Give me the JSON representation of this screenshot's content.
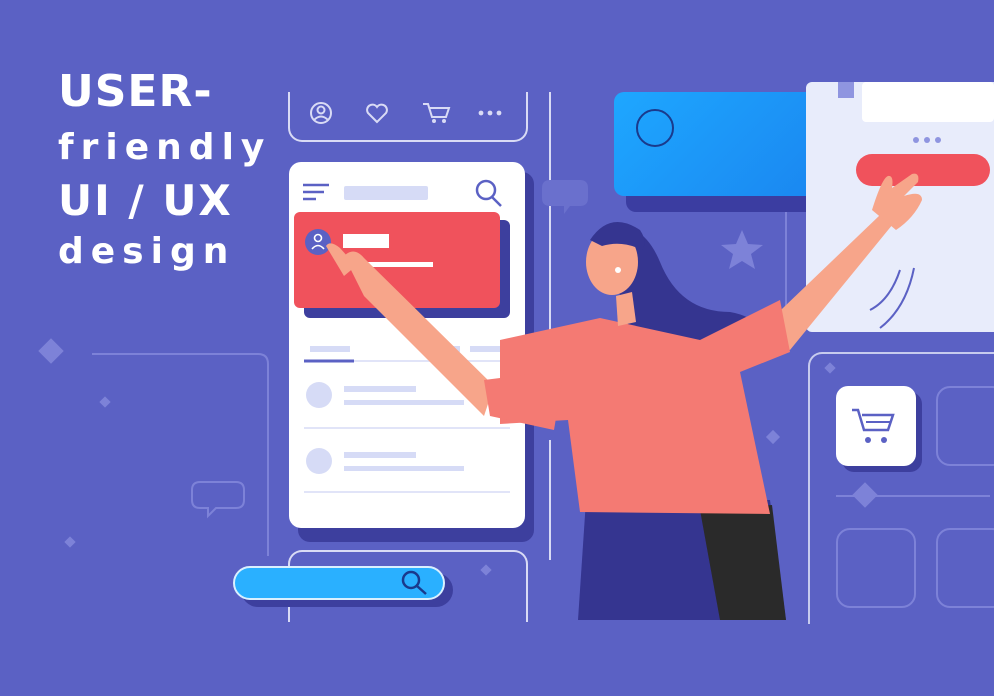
{
  "headline": {
    "line1": "USER-",
    "line2": "friendly",
    "line3": "UI / UX",
    "line4": "design"
  },
  "colors": {
    "background": "#5b61c4",
    "accent_red": "#f0525c",
    "accent_blue": "#1ea7ff",
    "panel_white": "#ffffff",
    "shadow": "#3d3f9e"
  },
  "icons": {
    "top_bar": [
      "user-icon",
      "heart-icon",
      "cart-icon",
      "more-dots-icon"
    ],
    "phone_header": [
      "menu-icon",
      "search-icon"
    ],
    "search_bar": "search-icon",
    "tile": "cart-icon"
  }
}
